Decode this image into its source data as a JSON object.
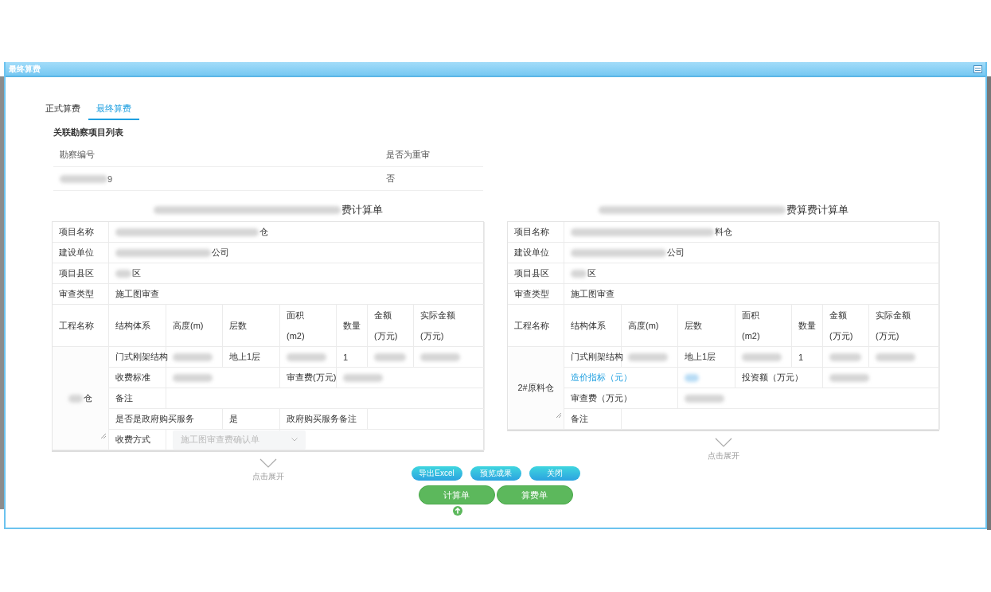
{
  "window": {
    "title": "最终算费"
  },
  "tabs": [
    {
      "label": "正式算费",
      "selected": false
    },
    {
      "label": "最终算费",
      "selected": true
    }
  ],
  "survey_list": {
    "title": "关联勘察项目列表",
    "columns": [
      "勘察编号",
      "是否为重审"
    ],
    "rows": [
      [
        {
          "text": "9",
          "blurred_prefix": true
        },
        {
          "text": "否",
          "blurred_prefix": false
        }
      ]
    ]
  },
  "sheets": [
    {
      "title": "费计算单",
      "info_rows": [
        {
          "label": "项目名称",
          "value": "仓",
          "blurred_prefix": true
        },
        {
          "label": "建设单位",
          "value": "公司",
          "blurred_prefix": true
        },
        {
          "label": "项目县区",
          "value": "区",
          "blurred_prefix": true
        },
        {
          "label": "审查类型",
          "value": "施工图审查",
          "blurred_prefix": false
        }
      ],
      "work_header": [
        "工程名称",
        "结构体系",
        "高度(m)",
        "层数",
        "面积\n(m2)",
        "数量",
        "金额\n(万元)",
        "实际金额\n(万元)"
      ],
      "work_name": {
        "text": "仓",
        "blurred_prefix": true
      },
      "rows": [
        [
          {
            "kind": "value",
            "text": "门式刚架结构"
          },
          {
            "kind": "blurred"
          },
          {
            "kind": "value",
            "text": "地上1层"
          },
          {
            "kind": "blurred"
          },
          {
            "kind": "value",
            "text": "1"
          },
          {
            "kind": "blurred"
          },
          {
            "kind": "blurred"
          }
        ],
        [
          {
            "kind": "value",
            "text": "收费标准"
          },
          {
            "kind": "blurred"
          },
          {
            "kind": "merged"
          },
          {
            "kind": "value",
            "text": "审查费(万元)"
          },
          {
            "kind": "blurred"
          },
          {
            "kind": "merged"
          },
          {
            "kind": "merged"
          }
        ],
        [
          {
            "kind": "value",
            "text": "备注"
          },
          {
            "kind": "empty"
          },
          {
            "kind": "merged"
          },
          {
            "kind": "merged"
          },
          {
            "kind": "merged"
          },
          {
            "kind": "merged"
          },
          {
            "kind": "merged"
          }
        ],
        [
          {
            "kind": "value",
            "text": "是否是政府购买服务"
          },
          {
            "kind": "merged"
          },
          {
            "kind": "value",
            "text": "是"
          },
          {
            "kind": "value",
            "text": "政府购买服务备注"
          },
          {
            "kind": "merged"
          },
          {
            "kind": "empty"
          },
          {
            "kind": "merged"
          }
        ],
        [
          {
            "kind": "value",
            "text": "收费方式"
          },
          {
            "kind": "select",
            "text": "施工图审查费确认单"
          },
          {
            "kind": "merged"
          },
          {
            "kind": "empty"
          },
          {
            "kind": "merged"
          },
          {
            "kind": "merged"
          },
          {
            "kind": "merged"
          }
        ]
      ],
      "expand": "点击展开"
    },
    {
      "title": "费算费计算单",
      "info_rows": [
        {
          "label": "项目名称",
          "value": "料仓",
          "blurred_prefix": true
        },
        {
          "label": "建设单位",
          "value": "公司",
          "blurred_prefix": true
        },
        {
          "label": "项目县区",
          "value": "区",
          "blurred_prefix": true
        },
        {
          "label": "审查类型",
          "value": "施工图审查",
          "blurred_prefix": false
        }
      ],
      "work_header": [
        "工程名称",
        "结构体系",
        "高度(m)",
        "层数",
        "面积\n(m2)",
        "数量",
        "金额\n(万元)",
        "实际金额\n(万元)"
      ],
      "work_name": {
        "text": "2#原料仓",
        "blurred_prefix": false
      },
      "rows": [
        [
          {
            "kind": "value",
            "text": "门式刚架结构"
          },
          {
            "kind": "blurred"
          },
          {
            "kind": "value",
            "text": "地上1层"
          },
          {
            "kind": "blurred"
          },
          {
            "kind": "value",
            "text": "1"
          },
          {
            "kind": "blurred"
          },
          {
            "kind": "blurred"
          }
        ],
        [
          {
            "kind": "link",
            "text": "造价指标（元）"
          },
          {
            "kind": "merged"
          },
          {
            "kind": "blurred-link"
          },
          {
            "kind": "value",
            "text": "投资额（万元）"
          },
          {
            "kind": "merged"
          },
          {
            "kind": "blurred"
          },
          {
            "kind": "merged"
          }
        ],
        [
          {
            "kind": "value",
            "text": "审查费（万元）"
          },
          {
            "kind": "merged"
          },
          {
            "kind": "blurred"
          },
          {
            "kind": "merged"
          },
          {
            "kind": "merged"
          },
          {
            "kind": "merged"
          },
          {
            "kind": "merged"
          }
        ],
        [
          {
            "kind": "value",
            "text": "备注"
          },
          {
            "kind": "empty"
          },
          {
            "kind": "merged"
          },
          {
            "kind": "merged"
          },
          {
            "kind": "merged"
          },
          {
            "kind": "merged"
          },
          {
            "kind": "merged"
          }
        ]
      ],
      "expand": "点击展开"
    }
  ],
  "action_buttons": [
    "导出Excel",
    "预览成果",
    "关闭"
  ],
  "sheet_buttons": [
    "计算单",
    "算费单"
  ]
}
